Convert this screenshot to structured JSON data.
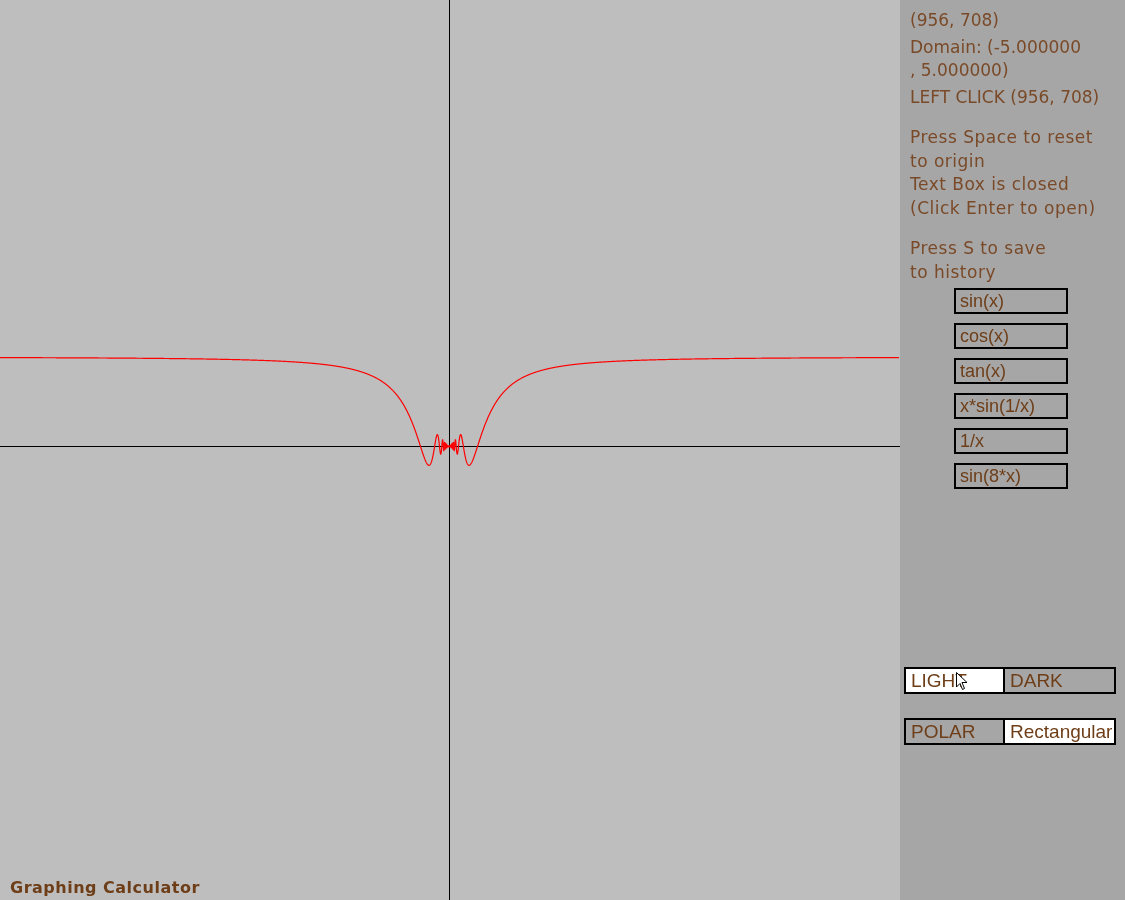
{
  "app_title": "Graphing Calculator",
  "info_lines": [
    {
      "text": "(956, 708)"
    },
    {
      "text": "Domain: (-5.000000"
    },
    {
      "text": ", 5.000000)"
    },
    {
      "text": "LEFT CLICK (956, 708)"
    }
  ],
  "help_groups": [
    [
      "Press Space to reset",
      "to origin",
      "Text Box is closed",
      "(Click Enter to open)"
    ],
    [
      "Press S to save",
      "to history"
    ]
  ],
  "history": [
    "sin(x)",
    "cos(x)",
    "tan(x)",
    "x*sin(1/x)",
    "1/x",
    "sin(8*x)"
  ],
  "toggles": [
    [
      {
        "label": "LIGHT",
        "selected": true
      },
      {
        "label": "DARK",
        "selected": false
      }
    ],
    [
      {
        "label": "POLAR",
        "selected": false
      },
      {
        "label": "Rectangular",
        "selected": true
      }
    ]
  ]
}
